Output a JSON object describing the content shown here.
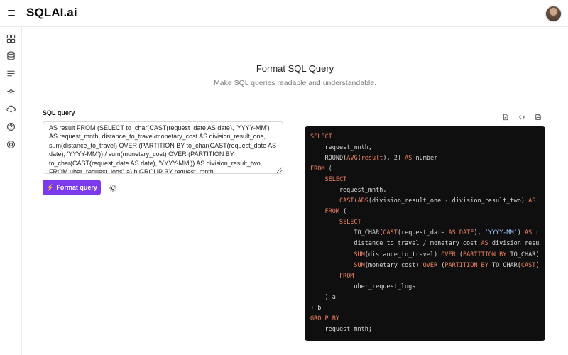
{
  "app": {
    "brand": "SQLAI.ai",
    "menu_icon": "hamburger-icon",
    "avatar_icon": "user-avatar"
  },
  "sidebar": {
    "items": [
      {
        "icon": "dashboard-icon"
      },
      {
        "icon": "database-icon"
      },
      {
        "icon": "list-lines-icon"
      },
      {
        "icon": "settings-gear-icon"
      },
      {
        "icon": "cloud-sync-icon"
      },
      {
        "icon": "help-circle-icon"
      },
      {
        "icon": "support-lifebuoy-icon"
      }
    ]
  },
  "page": {
    "title": "Format SQL Query",
    "subtitle": "Make SQL queries readable and understandable."
  },
  "form": {
    "label": "SQL query",
    "query_value": "AS result FROM (SELECT to_char(CAST(request_date AS date), 'YYYY-MM') AS request_mnth, distance_to_travel/monetary_cost AS division_result_one, sum(distance_to_travel) OVER (PARTITION BY to_char(CAST(request_date AS date), 'YYYY-MM')) / sum(monetary_cost) OVER (PARTITION BY to_char(CAST(request_date AS date), 'YYYY-MM')) AS division_result_two FROM uber_request_logs) a) b GROUP BY request_mnth",
    "format_button": "Format query",
    "format_icon": "lightning-icon",
    "settings_icon": "gear-icon"
  },
  "output": {
    "toolbar": [
      {
        "icon": "file-icon"
      },
      {
        "icon": "code-icon"
      },
      {
        "icon": "save-icon"
      }
    ],
    "colors": {
      "background": "#0f0f10",
      "keyword": "#f08262",
      "string": "#9ecbff",
      "text": "#d8d8d8"
    },
    "lines": [
      [
        {
          "t": "SELECT",
          "c": "kw"
        }
      ],
      [
        {
          "t": "    request_mnth,",
          "c": ""
        }
      ],
      [
        {
          "t": "    ",
          "c": ""
        },
        {
          "t": "ROUND",
          "c": ""
        },
        {
          "t": "(",
          "c": ""
        },
        {
          "t": "AVG",
          "c": "kw"
        },
        {
          "t": "(",
          "c": ""
        },
        {
          "t": "result",
          "c": "kw"
        },
        {
          "t": "), 2) ",
          "c": ""
        },
        {
          "t": "AS",
          "c": "kw"
        },
        {
          "t": " number",
          "c": ""
        }
      ],
      [
        {
          "t": "FROM",
          "c": "kw"
        },
        {
          "t": " (",
          "c": ""
        }
      ],
      [
        {
          "t": "    ",
          "c": ""
        },
        {
          "t": "SELECT",
          "c": "kw"
        }
      ],
      [
        {
          "t": "        request_mnth,",
          "c": ""
        }
      ],
      [
        {
          "t": "        ",
          "c": ""
        },
        {
          "t": "CAST",
          "c": "kw"
        },
        {
          "t": "(",
          "c": ""
        },
        {
          "t": "ABS",
          "c": "kw"
        },
        {
          "t": "(division_result_one - division_result_two) ",
          "c": ""
        },
        {
          "t": "AS",
          "c": "kw"
        }
      ],
      [
        {
          "t": "    ",
          "c": ""
        },
        {
          "t": "FROM",
          "c": "kw"
        },
        {
          "t": " (",
          "c": ""
        }
      ],
      [
        {
          "t": "        ",
          "c": ""
        },
        {
          "t": "SELECT",
          "c": "kw"
        }
      ],
      [
        {
          "t": "            TO_CHAR(",
          "c": ""
        },
        {
          "t": "CAST",
          "c": "kw"
        },
        {
          "t": "(request_date ",
          "c": ""
        },
        {
          "t": "AS DATE",
          "c": "kw"
        },
        {
          "t": "), ",
          "c": ""
        },
        {
          "t": "'YYYY-MM'",
          "c": "str"
        },
        {
          "t": ") ",
          "c": ""
        },
        {
          "t": "AS",
          "c": "kw"
        },
        {
          "t": " r",
          "c": ""
        }
      ],
      [
        {
          "t": "            distance_to_travel / monetary_cost ",
          "c": ""
        },
        {
          "t": "AS",
          "c": "kw"
        },
        {
          "t": " division_resu",
          "c": ""
        }
      ],
      [
        {
          "t": "            ",
          "c": ""
        },
        {
          "t": "SUM",
          "c": "kw"
        },
        {
          "t": "(distance_to_travel) ",
          "c": ""
        },
        {
          "t": "OVER",
          "c": "kw"
        },
        {
          "t": " (",
          "c": ""
        },
        {
          "t": "PARTITION BY",
          "c": "kw"
        },
        {
          "t": " TO_CHAR(",
          "c": ""
        }
      ],
      [
        {
          "t": "            ",
          "c": ""
        },
        {
          "t": "SUM",
          "c": "kw"
        },
        {
          "t": "(monetary_cost) ",
          "c": ""
        },
        {
          "t": "OVER",
          "c": "kw"
        },
        {
          "t": " (",
          "c": ""
        },
        {
          "t": "PARTITION BY",
          "c": "kw"
        },
        {
          "t": " TO_CHAR(",
          "c": ""
        },
        {
          "t": "CAST",
          "c": "kw"
        },
        {
          "t": "(",
          "c": ""
        }
      ],
      [
        {
          "t": "        ",
          "c": ""
        },
        {
          "t": "FROM",
          "c": "kw"
        }
      ],
      [
        {
          "t": "            uber_request_logs",
          "c": ""
        }
      ],
      [
        {
          "t": "    ) a",
          "c": ""
        }
      ],
      [
        {
          "t": ") b",
          "c": ""
        }
      ],
      [
        {
          "t": "GROUP BY",
          "c": "kw"
        }
      ],
      [
        {
          "t": "    request_mnth;",
          "c": ""
        }
      ]
    ]
  }
}
